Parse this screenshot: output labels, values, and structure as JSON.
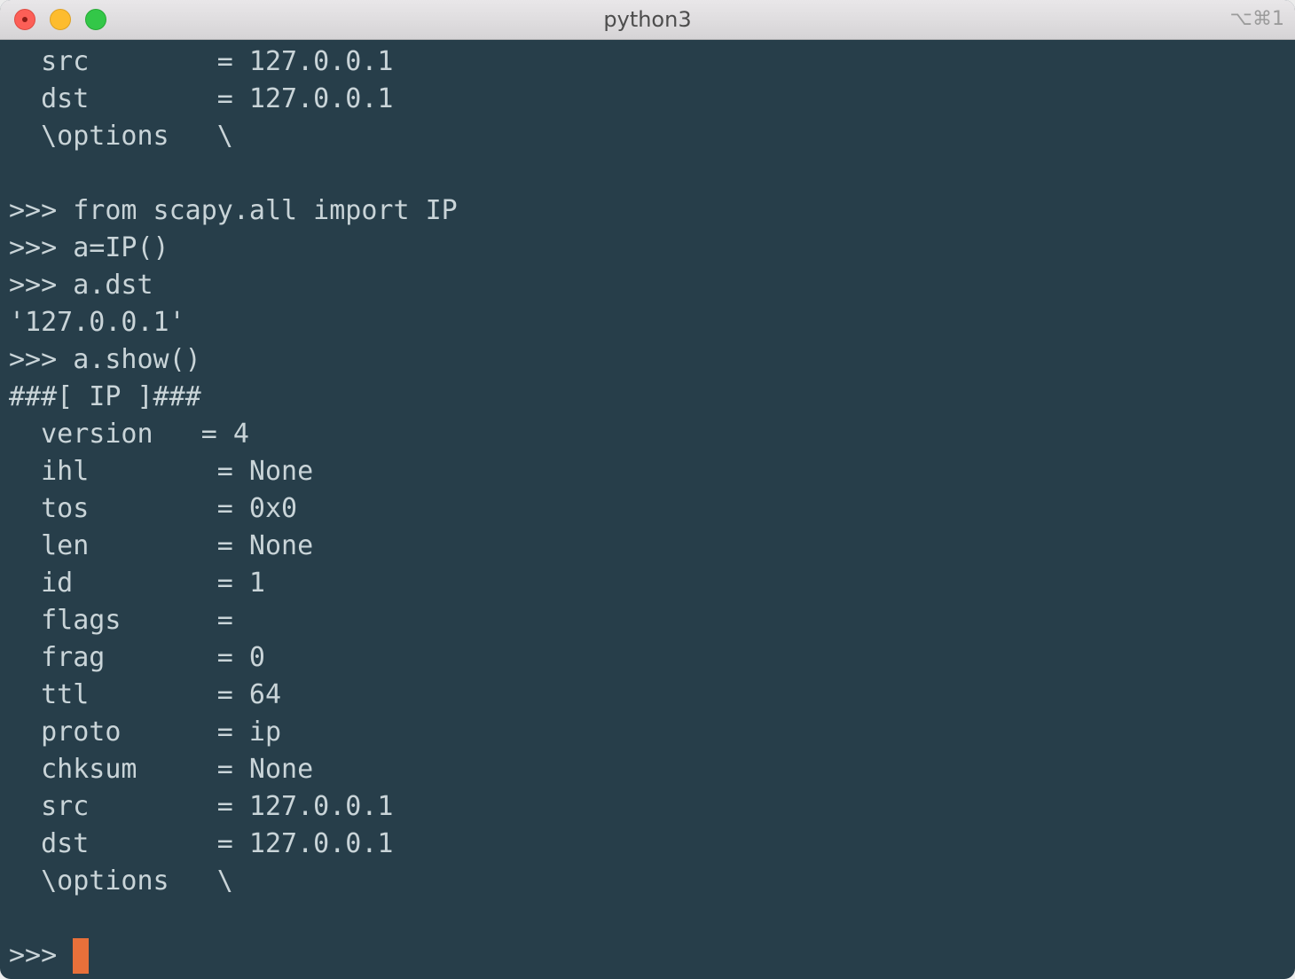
{
  "window": {
    "title": "python3",
    "shortcut": "⌥⌘1"
  },
  "colors": {
    "background": "#273e4a",
    "text": "#c9d4d8",
    "cursor": "#e8703a"
  },
  "terminal": {
    "lines": [
      "  src        = 127.0.0.1",
      "  dst        = 127.0.0.1",
      "  \\options   \\",
      "",
      ">>> from scapy.all import IP",
      ">>> a=IP()",
      ">>> a.dst",
      "'127.0.0.1'",
      ">>> a.show()",
      "###[ IP ]###",
      "  version   = 4",
      "  ihl        = None",
      "  tos        = 0x0",
      "  len        = None",
      "  id         = 1",
      "  flags      =",
      "  frag       = 0",
      "  ttl        = 64",
      "  proto      = ip",
      "  chksum     = None",
      "  src        = 127.0.0.1",
      "  dst        = 127.0.0.1",
      "  \\options   \\",
      ""
    ],
    "prompt": ">>> "
  }
}
